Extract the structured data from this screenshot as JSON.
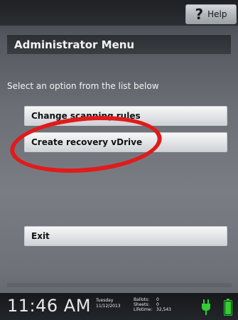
{
  "header": {
    "help_label": "Help",
    "help_icon": "question-mark-icon"
  },
  "menu": {
    "title": "Administrator Menu",
    "instructions": "Select an option from the list below",
    "options": [
      {
        "label": "Change scanning rules"
      },
      {
        "label": "Create recovery vDrive"
      }
    ],
    "exit_label": "Exit"
  },
  "status": {
    "time": "11:46 AM",
    "day": "Tuesday",
    "date": "11/12/2013",
    "ballots_label": "Ballots:",
    "ballots_value": "0",
    "sheets_label": "Sheets:",
    "sheets_value": "0",
    "lifetime_label": "Lifetime:",
    "lifetime_value": "32,543",
    "power_icon": "power-plug-icon",
    "battery_icon": "battery-icon",
    "icon_color": "#33cc33"
  },
  "annotation": {
    "highlight_color": "#e11a1a"
  }
}
